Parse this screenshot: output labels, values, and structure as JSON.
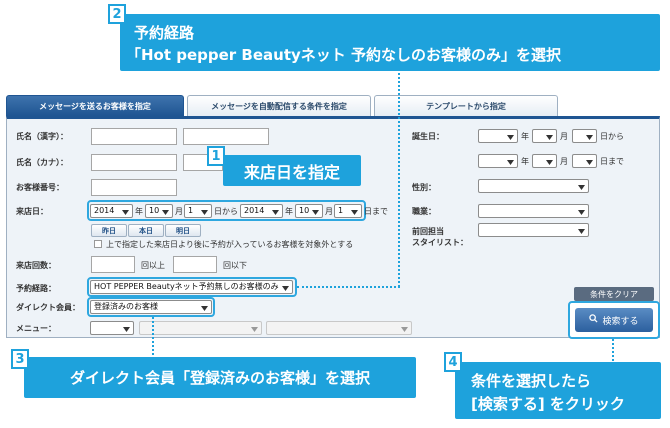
{
  "tabs": [
    "メッセージを送るお客様を指定",
    "メッセージを自動配信する条件を指定",
    "テンプレートから指定"
  ],
  "left": {
    "name_kanji": "氏名（漢字）：",
    "name_kana": "氏名（カナ）：",
    "customer_no": "お客様番号：",
    "visit_date": "来店日：",
    "visit_from": {
      "year": "2014",
      "month": "10",
      "day": "1"
    },
    "visit_to": {
      "year": "2014",
      "month": "10",
      "day": "1"
    },
    "year_unit": "年",
    "month_unit": "月",
    "from_unit": "日から",
    "to_unit": "日まで",
    "quick_buttons": [
      "昨日",
      "本日",
      "明日"
    ],
    "checkbox_label": "上で指定した来店日より後に予約が入っているお客様を対象外とする",
    "visit_count": "来店回数：",
    "over": "回以上",
    "under": "回以下",
    "route": "予約経路：",
    "route_value": "HOT PEPPER Beautyネット予約無しのお客様のみ",
    "direct": "ダイレクト会員：",
    "direct_value": "登録済みのお客様",
    "menu": "メニュー："
  },
  "right": {
    "birthday": "誕生日：",
    "year_unit": "年",
    "month_unit": "月",
    "from": "日から",
    "to": "日まで",
    "gender": "性別：",
    "job": "職業：",
    "stylist_1": "前回担当",
    "stylist_2": "スタイリスト："
  },
  "clear_button": "条件をクリア",
  "search_button": "検索する",
  "callouts": {
    "c1": {
      "num": "1",
      "text": "来店日を指定"
    },
    "c2": {
      "num": "2",
      "line1": "予約経路",
      "line2": "「Hot pepper Beautyネット 予約なしのお客様のみ」を選択"
    },
    "c3": {
      "num": "3",
      "text": "ダイレクト会員「登録済みのお客様」を選択"
    },
    "c4": {
      "num": "4",
      "line1": "条件を選択したら",
      "line2": "[検索する] をクリック"
    }
  },
  "colors": {
    "accent": "#1ea2dc",
    "tab_active": "#1f5592",
    "panel": "#eef3f8"
  }
}
